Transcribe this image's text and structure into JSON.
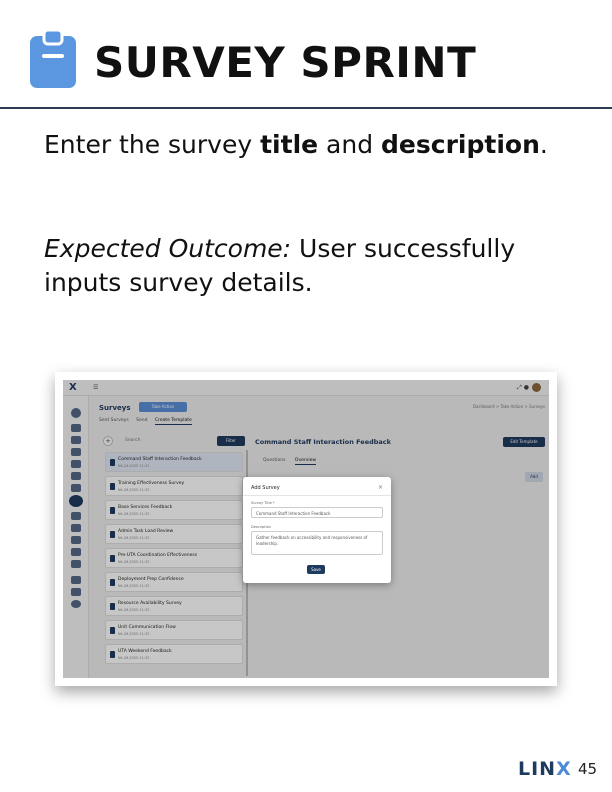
{
  "header": {
    "title": "SURVEY SPRINT",
    "icon": "clipboard-icon",
    "accent_color": "#5b97e0"
  },
  "instruction": {
    "prefix": "Enter the survey ",
    "bold1": "title",
    "middle": " and ",
    "bold2": "description",
    "suffix": "."
  },
  "outcome": {
    "label": "Expected Outcome:",
    "text": " User successfully inputs survey details."
  },
  "screenshot": {
    "app_logo": "X",
    "page_title": "Surveys",
    "take_action": "Take Action",
    "breadcrumb": "Dashboard > Take Action > Surveys",
    "subtabs": [
      "Sent Surveys",
      "Send",
      "Create Template"
    ],
    "search_placeholder": "Search",
    "filter_label": "Filter",
    "surveys": [
      {
        "name": "Command Staff Interaction Feedback",
        "date": "06-26-2025 11:32"
      },
      {
        "name": "Training Effectiveness Survey",
        "date": "06-26-2025 11:32"
      },
      {
        "name": "Base Services Feedback",
        "date": "06-26-2025 11:32"
      },
      {
        "name": "Admin Task Load Review",
        "date": "06-26-2025 11:32"
      },
      {
        "name": "Pre-UTA Coordination Effectiveness",
        "date": "06-26-2025 11:32"
      },
      {
        "name": "Deployment Prep Confidence",
        "date": "06-26-2025 11:32"
      },
      {
        "name": "Resource Availability Survey",
        "date": "06-26-2025 11:32"
      },
      {
        "name": "Unit Communication Flow",
        "date": "06-26-2025 11:32"
      },
      {
        "name": "UTA Weekend Feedback",
        "date": "06-26-2025 11:32"
      }
    ],
    "detail_title": "Command Staff Interaction Feedback",
    "edit_template": "Edit Template",
    "detail_tabs": [
      "Questions",
      "Overview"
    ],
    "add_label": "Add",
    "modal": {
      "title": "Add Survey",
      "close": "×",
      "title_label": "Survey Title *",
      "title_value": "Command Staff Interaction Feedback",
      "desc_label": "Description",
      "desc_value": "Gather feedback on accessibility and responsiveness of leadership.",
      "save": "Save"
    }
  },
  "footer": {
    "brand_prefix": "LIN",
    "brand_x": "X",
    "page_number": "45"
  }
}
